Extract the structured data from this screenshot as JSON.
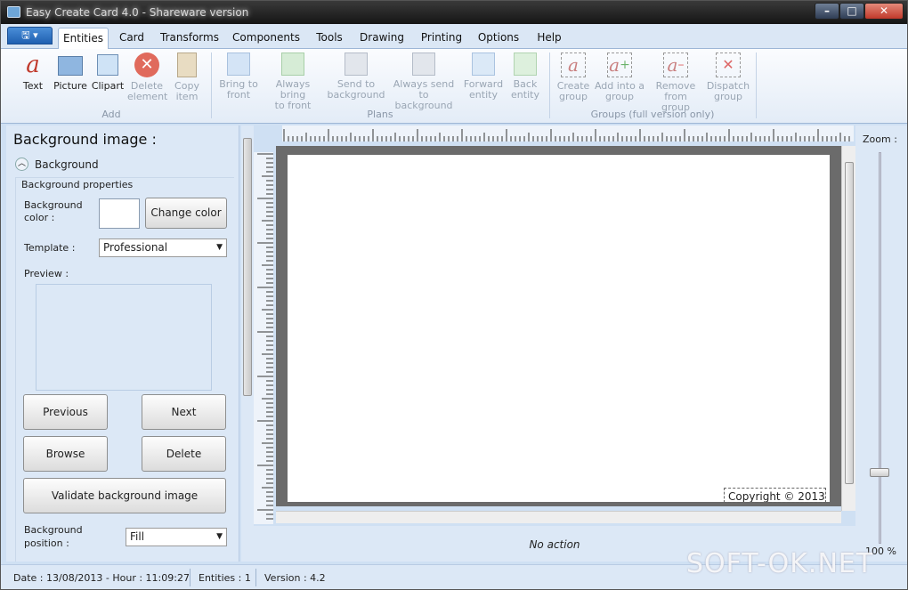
{
  "window": {
    "title": "Easy Create Card 4.0 - Shareware version"
  },
  "tabs": [
    {
      "label": "Entities",
      "active": true
    },
    {
      "label": "Card"
    },
    {
      "label": "Transforms"
    },
    {
      "label": "Components"
    },
    {
      "label": "Tools"
    },
    {
      "label": "Drawing"
    },
    {
      "label": "Printing"
    },
    {
      "label": "Options"
    },
    {
      "label": "Help"
    }
  ],
  "ribbon": {
    "add": {
      "group_label": "Add",
      "text": "Text",
      "picture": "Picture",
      "clipart": "Clipart",
      "delete_1": "Delete",
      "delete_2": "element",
      "copy_1": "Copy",
      "copy_2": "item"
    },
    "plans": {
      "group_label": "Plans",
      "bring_front_1": "Bring to",
      "bring_front_2": "front",
      "always_bring_1": "Always bring",
      "always_bring_2": "to front",
      "send_back_1": "Send to",
      "send_back_2": "background",
      "always_send_1": "Always send to",
      "always_send_2": "background",
      "forward_1": "Forward",
      "forward_2": "entity",
      "back_1": "Back",
      "back_2": "entity"
    },
    "groups": {
      "group_label": "Groups (full version only)",
      "create_1": "Create",
      "create_2": "group",
      "addinto_1": "Add into a",
      "addinto_2": "group",
      "remove_1": "Remove",
      "remove_2": "from group",
      "dispatch_1": "Dispatch",
      "dispatch_2": "group"
    }
  },
  "left_panel": {
    "title": "Background image :",
    "section": "Background",
    "props_title": "Background properties",
    "bg_color_label_1": "Background",
    "bg_color_label_2": "color :",
    "change_color": "Change color",
    "template_label": "Template :",
    "template_value": "Professional",
    "preview_label": "Preview :",
    "previous": "Previous",
    "next": "Next",
    "browse": "Browse",
    "delete": "Delete",
    "validate": "Validate background image",
    "position_label_1": "Background",
    "position_label_2": "position :",
    "position_value": "Fill"
  },
  "canvas": {
    "copyright": "Copyright © 2013",
    "status": "No action"
  },
  "zoom": {
    "label": "Zoom :",
    "value": "100 %",
    "level_percent": 100
  },
  "statusbar": {
    "date": "Date : 13/08/2013  -  Hour : 11:09:27",
    "entities": "Entities : 1",
    "version": "Version : 4.2"
  },
  "watermark": "SOFT-OK.NET",
  "colors": {
    "accent": "#1f5fb0",
    "panel": "#dce8f6",
    "canvas_border": "#6b6b6b"
  }
}
